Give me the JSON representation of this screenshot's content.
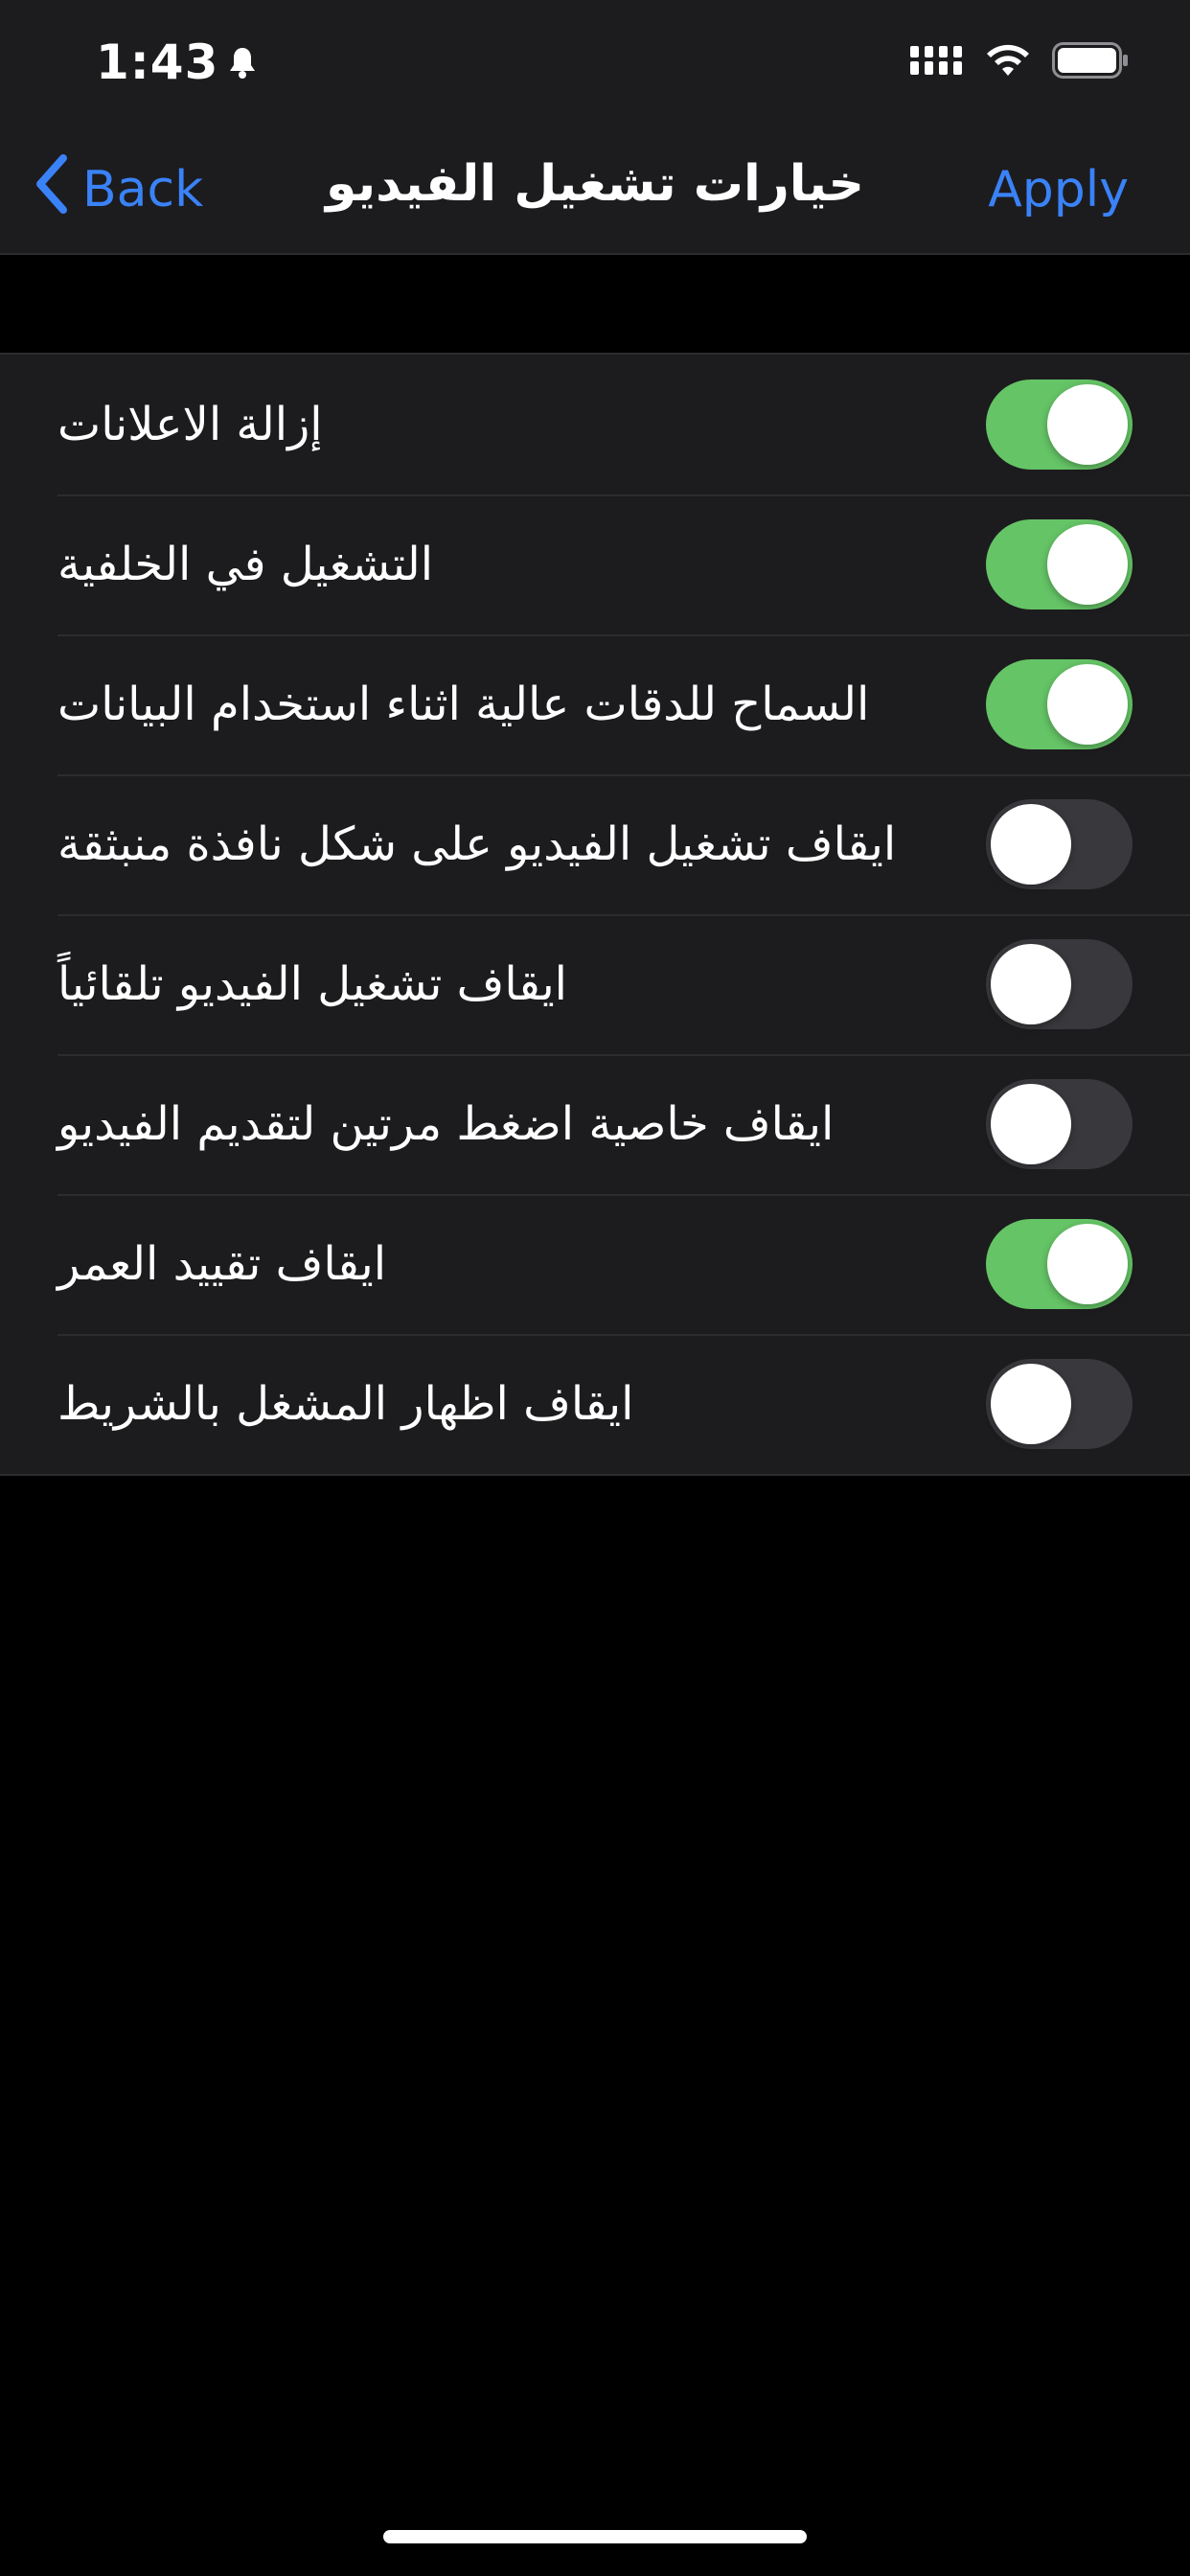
{
  "status_bar": {
    "time": "1:43"
  },
  "nav": {
    "back_label": "Back",
    "title": "خيارات تشغيل الفيديو",
    "apply_label": "Apply"
  },
  "settings": [
    {
      "label": "إزالة الاعلانات",
      "enabled": true
    },
    {
      "label": "التشغيل في الخلفية",
      "enabled": true
    },
    {
      "label": "السماح للدقات عالية اثناء استخدام البيانات",
      "enabled": true
    },
    {
      "label": "ايقاف تشغيل الفيديو على شكل نافذة منبثقة",
      "enabled": false
    },
    {
      "label": "ايقاف تشغيل الفيديو تلقائياً",
      "enabled": false
    },
    {
      "label": "ايقاف خاصية اضغط مرتين لتقديم الفيديو",
      "enabled": false
    },
    {
      "label": "ايقاف تقييد العمر",
      "enabled": true
    },
    {
      "label": "ايقاف اظهار المشغل بالشريط",
      "enabled": false
    }
  ],
  "colors": {
    "accent": "#3a82f7",
    "toggle_on": "#65c466",
    "toggle_off": "#39393d",
    "background": "#000000",
    "surface": "#1c1c1e"
  }
}
